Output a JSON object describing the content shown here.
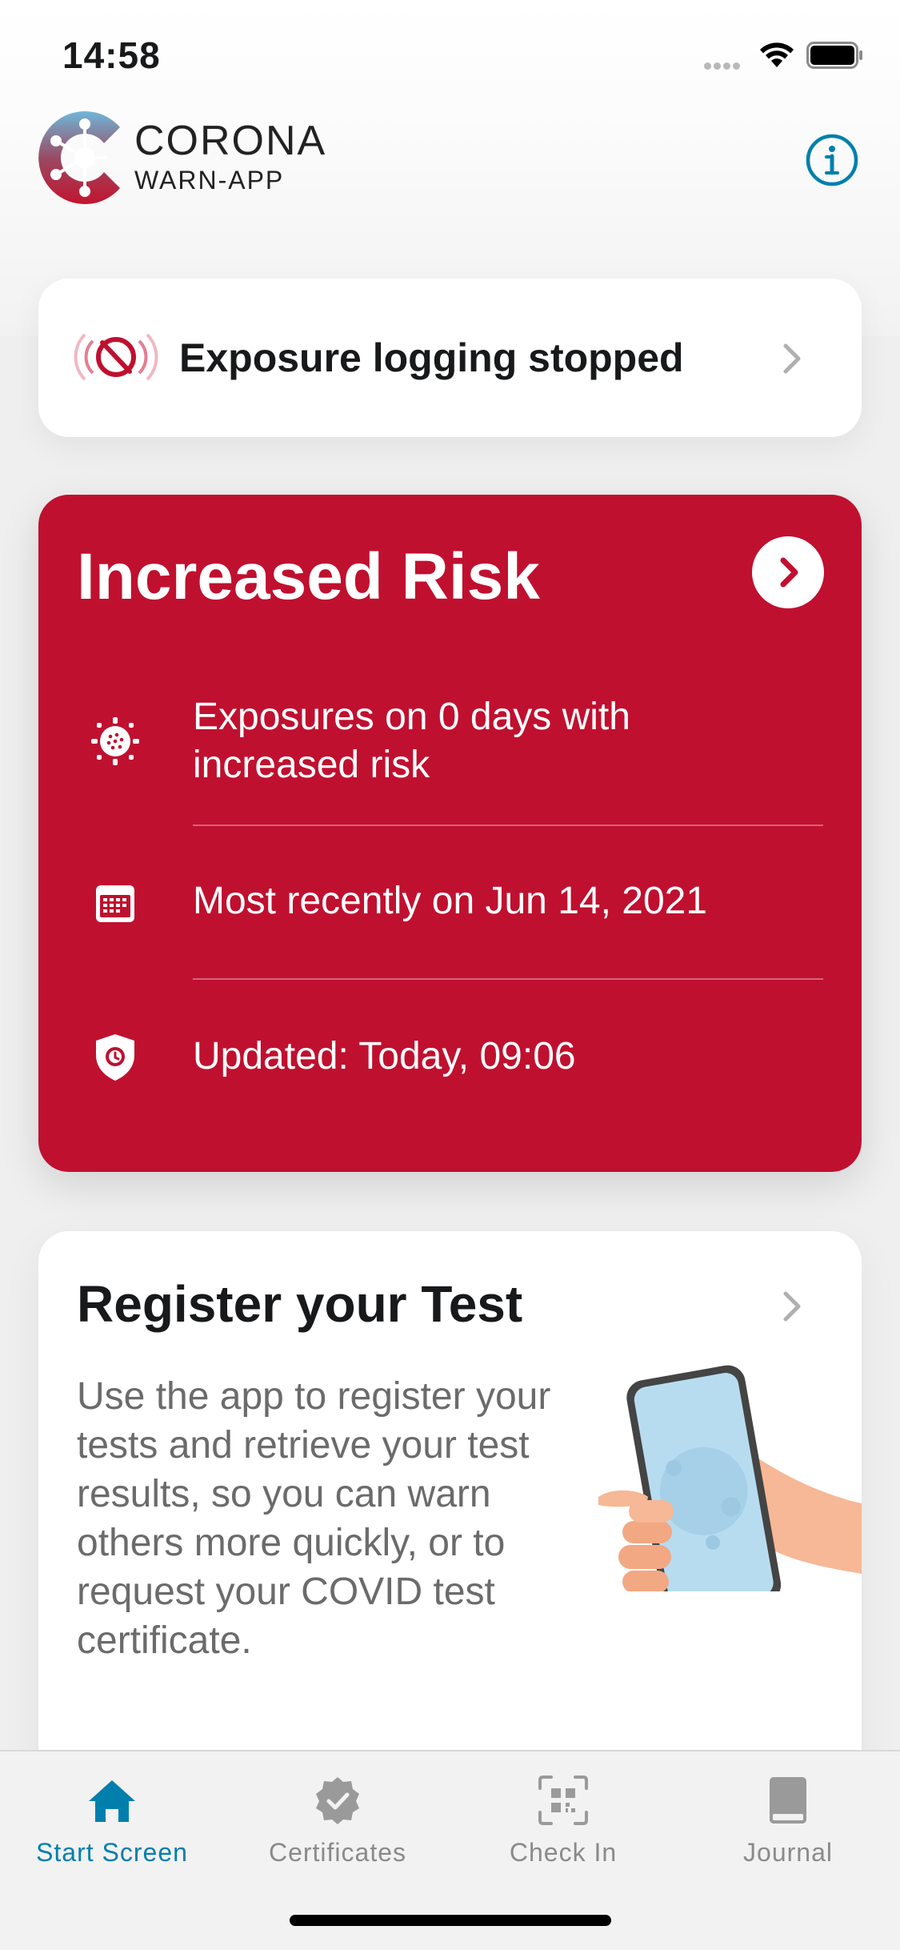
{
  "status_bar": {
    "time": "14:58"
  },
  "header": {
    "logo_title": "CORONA",
    "logo_subtitle": "WARN-APP",
    "info_icon": "info-circle-icon"
  },
  "exposure_card": {
    "label": "Exposure logging stopped",
    "icon": "exposure-stopped-icon"
  },
  "risk_card": {
    "title": "Increased Risk",
    "background_color": "#c0102f",
    "rows": [
      {
        "icon": "virus-icon",
        "text": "Exposures on 0 days with increased risk"
      },
      {
        "icon": "calendar-icon",
        "text": "Most recently on Jun 14, 2021"
      },
      {
        "icon": "shield-clock-icon",
        "text": "Updated: Today, 09:06"
      }
    ]
  },
  "register_card": {
    "title": "Register your Test",
    "description": "Use the app to register your tests and retrieve your test results, so you can warn others more quickly, or to request your COVID test certificate.",
    "illustration": "hand-holding-phone-illustration"
  },
  "tab_bar": {
    "active_color": "#007fad",
    "tabs": [
      {
        "label": "Start Screen",
        "icon": "home-icon",
        "active": true
      },
      {
        "label": "Certificates",
        "icon": "certificate-badge-icon",
        "active": false
      },
      {
        "label": "Check In",
        "icon": "qr-scan-icon",
        "active": false
      },
      {
        "label": "Journal",
        "icon": "journal-book-icon",
        "active": false
      }
    ]
  }
}
